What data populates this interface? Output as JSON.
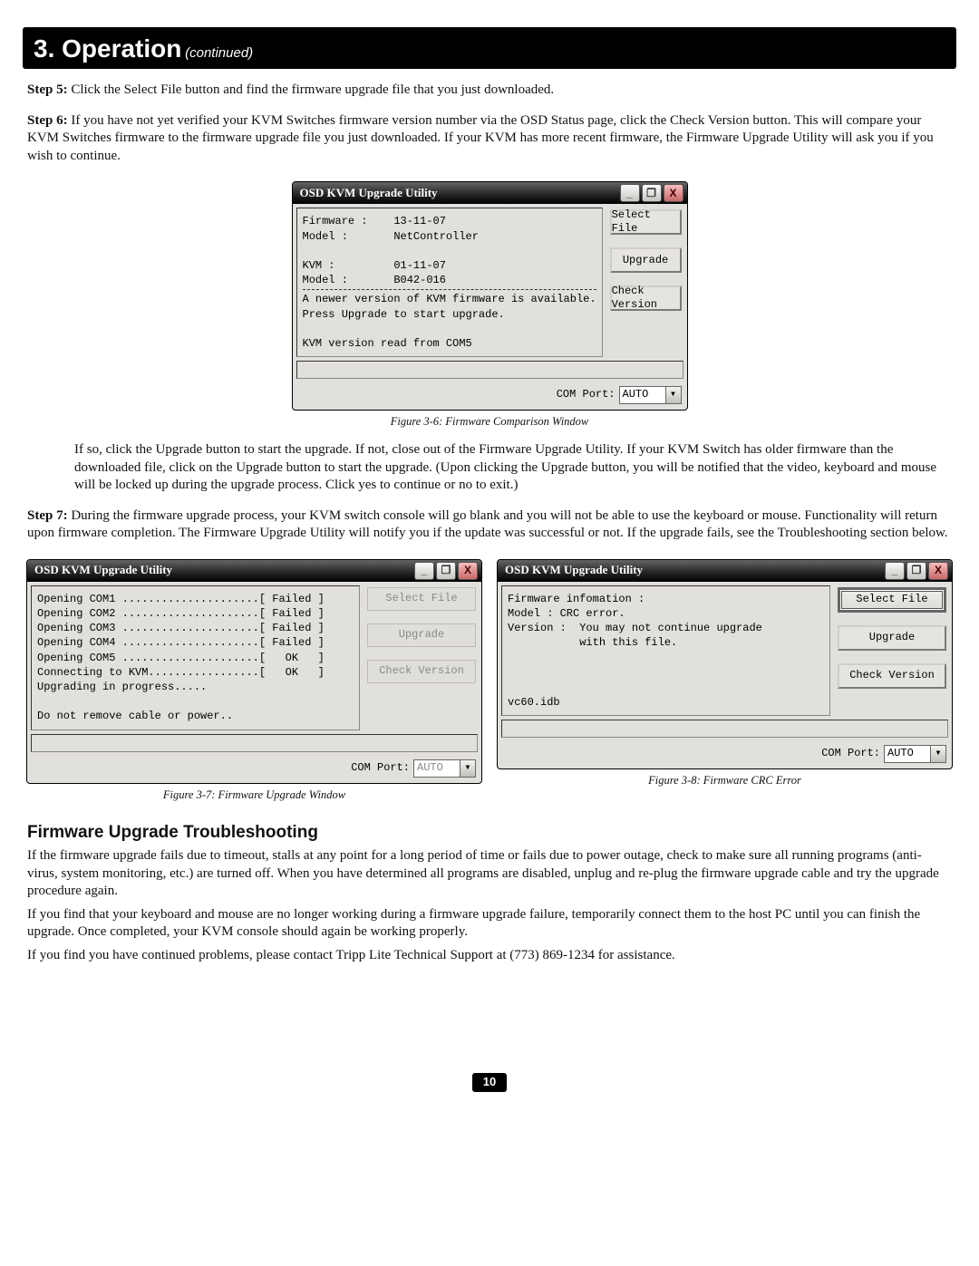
{
  "header": {
    "title": "3. Operation",
    "continued": "(continued)"
  },
  "steps": {
    "s5": {
      "label": "Step 5:",
      "text": "Click the Select File button and find the firmware upgrade file that you just downloaded."
    },
    "s6": {
      "label": "Step 6:",
      "text": "If you have not yet verified your KVM Switches firmware version number via the OSD Status page, click the Check Version button. This will compare your KVM Switches firmware to the firmware upgrade file you just downloaded. If your KVM has more recent firmware, the Firmware Upgrade Utility will ask you if you wish to continue."
    },
    "s6b": "If so, click the Upgrade button to start the upgrade. If not, close out of the Firmware Upgrade Utility. If your KVM Switch has older firmware than the downloaded file, click on the Upgrade button to start the upgrade. (Upon clicking the Upgrade button, you will be notified that the video, keyboard and mouse will be locked up during the upgrade process. Click yes to continue or no to exit.)",
    "s7": {
      "label": "Step 7:",
      "text": "During the firmware upgrade process, your KVM switch console will go blank and you will not be able to use the keyboard or mouse. Functionality will return upon firmware completion. The Firmware Upgrade Utility will notify you if the update was successful or not. If the upgrade fails, see the Troubleshooting section below."
    }
  },
  "util_common": {
    "title": "OSD KVM Upgrade Utility",
    "btn_select_file": "Select File",
    "btn_upgrade": "Upgrade",
    "btn_check_version": "Check Version",
    "com_port_label": "COM Port:",
    "com_port_value": "AUTO",
    "win_min": "_",
    "win_max": "❐",
    "win_close": "X"
  },
  "fig36": {
    "caption": "Figure 3-6: Firmware Comparison Window",
    "lines": {
      "l1": "Firmware :    13-11-07",
      "l2": "Model :       NetController",
      "blank1": " ",
      "l3": "KVM :         01-11-07",
      "l4": "Model :       B042-016",
      "l5": "A newer version of KVM firmware is available.",
      "l6": "Press Upgrade to start upgrade.",
      "blank2": " ",
      "l7": "KVM version read from COM5"
    }
  },
  "fig37": {
    "caption": "Figure 3-7: Firmware Upgrade Window",
    "lines": {
      "l1": "Opening COM1 .....................[ Failed ]",
      "l2": "Opening COM2 .....................[ Failed ]",
      "l3": "Opening COM3 .....................[ Failed ]",
      "l4": "Opening COM4 .....................[ Failed ]",
      "l5": "Opening COM5 .....................[   OK   ]",
      "l6": "Connecting to KVM.................[   OK   ]",
      "l7": "Upgrading in progress.....",
      "blank": " ",
      "l8": "Do not remove cable or power.."
    }
  },
  "fig38": {
    "caption": "Figure 3-8: Firmware CRC Error",
    "lines": {
      "l1": "Firmware infomation :",
      "l2": "Model : CRC error.",
      "l3": "Version :  You may not continue upgrade",
      "l4": "           with this file.",
      "status": "vc60.idb"
    }
  },
  "troubleshoot": {
    "heading": "Firmware Upgrade Troubleshooting",
    "p1": "If the firmware upgrade fails due to timeout, stalls at any point for a long period of time or fails due to power outage, check to make sure all running programs (anti-virus, system monitoring, etc.) are turned off. When you have determined all programs are disabled, unplug and re-plug the firmware upgrade cable and try the upgrade procedure again.",
    "p2": "If you find that your keyboard and mouse are no longer working during a firmware upgrade failure, temporarily connect them to the host PC until you can finish the upgrade. Once completed, your KVM console should again be working properly.",
    "p3": "If you find you have continued problems, please contact Tripp Lite Technical Support at (773) 869-1234 for assistance."
  },
  "page_number": "10"
}
